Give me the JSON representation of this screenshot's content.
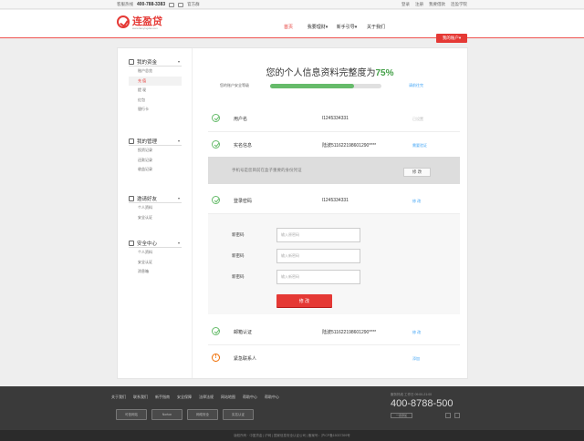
{
  "topbar": {
    "hotline_label": "客服热线",
    "hotline": "400-788-3383",
    "official_label": "官方群",
    "links": [
      "登录",
      "注册",
      "我要借款",
      "连盈学院"
    ]
  },
  "header": {
    "logo_text": "连盈贷",
    "logo_sub": "www.lianyingdai.com",
    "nav": [
      "首页",
      "我要理财",
      "新手引导",
      "关于我们"
    ],
    "nav_active": 0,
    "account_btn": "我的账户"
  },
  "sidebar": {
    "groups": [
      {
        "title": "我的资金",
        "items": [
          "账户总览",
          "充 值",
          "提 现",
          "红包",
          "银行卡"
        ],
        "active_index": 1
      },
      {
        "title": "我的管理",
        "items": [
          "投资记录",
          "还款记录",
          "收益记录"
        ],
        "active_index": -1
      },
      {
        "title": "邀请好友",
        "items": [
          "个人资料",
          "安全认证"
        ],
        "active_index": -1
      },
      {
        "title": "安全中心",
        "items": [
          "个人资料",
          "安全认证",
          "消息箱"
        ],
        "active_index": -1
      }
    ]
  },
  "main": {
    "title_prefix": "您的个人信息资料完整度为",
    "title_percent": "75%",
    "progress_label": "您的账户安全等级",
    "progress_value": 0.75,
    "progress_link": "请前往完",
    "rows": [
      {
        "label": "用户名",
        "value": "l1245334331",
        "action": "已设置",
        "action_gray": true
      },
      {
        "label": "实名信息",
        "value": "陆波511622198601290****",
        "action": "需要验证",
        "action_gray": false
      }
    ],
    "notice": {
      "message": "手机号是您目前在盒子重要的身份凭证",
      "button": "修 改"
    },
    "password_row": {
      "label": "登录密码",
      "value": "l1245334331",
      "action": "修 改"
    },
    "password_form": {
      "fields": [
        {
          "label": "新密码",
          "placeholder": "输入原密码"
        },
        {
          "label": "新密码",
          "placeholder": "输入新密码"
        },
        {
          "label": "新密码",
          "placeholder": "输入新密码"
        }
      ],
      "submit": "修 改"
    },
    "rows_bottom": [
      {
        "label": "邮箱认证",
        "value": "陆波511622198601290****",
        "action": "修 改",
        "icon": "check"
      },
      {
        "label": "紧急联系人",
        "value": "",
        "action": "添加",
        "icon": "warn"
      }
    ]
  },
  "footer": {
    "links": [
      "关于我们",
      "联系我们",
      "新手指南",
      "安全保障",
      "法律法规",
      "网站地图",
      "帮助中心",
      "帮助中心"
    ],
    "badges": [
      "可信网站",
      "Norton",
      "网络安全",
      "实名认证"
    ],
    "hotline_label": "服务热线 工作日 09:00-21:00",
    "hotline": "400-8788-500",
    "qr_label": "一键添加",
    "copyright": "版权所有 · 中盈贷金 | 沪网 | 国家信息安全认证公司 | 备案号：沪ICP备15037399号"
  },
  "colors": {
    "accent": "#e53935",
    "success": "#66bb6a",
    "link": "#42a5f5",
    "warning": "#ef6c00"
  }
}
